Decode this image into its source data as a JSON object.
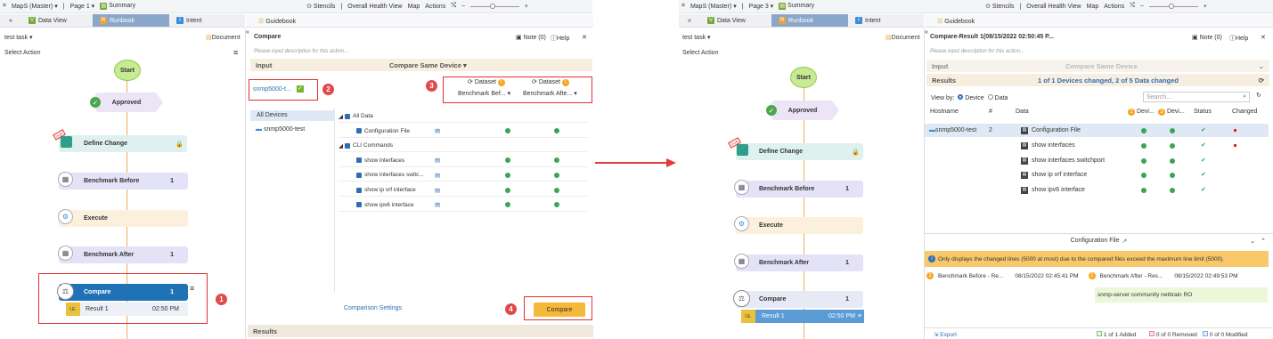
{
  "left": {
    "topbar": {
      "map": "MapS (Master)",
      "page": "Page 1",
      "summary": "Summary",
      "stencils": "Stencils",
      "overall": "Overall Health View",
      "map_menu": "Map",
      "actions": "Actions"
    },
    "tabs": [
      "Data View",
      "Runbook",
      "Intent"
    ],
    "guidebook": "Guidebook",
    "runbook": {
      "task": "test task",
      "document": "Document",
      "select_action": "Select Action",
      "nodes": {
        "start": "Start",
        "approved": "Approved",
        "define_change": "Define Change",
        "benchmark_before": "Benchmark Before",
        "benchmark_before_count": "1",
        "execute": "Execute",
        "benchmark_after": "Benchmark After",
        "benchmark_after_count": "1",
        "compare": "Compare",
        "compare_count": "1",
        "result": "Result 1",
        "result_time": "02:50 PM",
        "draft_tag": "Draft"
      }
    },
    "compare": {
      "title": "Compare",
      "note": "Note (0)",
      "help": "Help",
      "placeholder": "Please input description for this action...",
      "input": "Input",
      "mode": "Compare Same Device",
      "device_chip": "snmp5000-t...",
      "dataset1": "Dataset",
      "dataset2": "Dataset",
      "ds1_value": "Benchmark Bef...",
      "ds2_value": "Benchmark Afte...",
      "devices": [
        "All Devices",
        "snmp5000-test"
      ],
      "data_rows": [
        {
          "label": "All Data",
          "kind": "head"
        },
        {
          "label": "Configuration File",
          "kind": "item"
        },
        {
          "label": "CLI Commands",
          "kind": "head"
        },
        {
          "label": "show interfaces",
          "kind": "cmd"
        },
        {
          "label": "show interfaces switc...",
          "kind": "cmd"
        },
        {
          "label": "show ip vrf interface",
          "kind": "cmd"
        },
        {
          "label": "show ipv6 interface",
          "kind": "cmd"
        }
      ],
      "settings": "Comparison Settings",
      "compare_btn": "Compare",
      "results": "Results"
    },
    "callouts": [
      "1",
      "2",
      "3",
      "4"
    ]
  },
  "right": {
    "topbar": {
      "map": "MapS (Master)",
      "page": "Page 3",
      "summary": "Summary",
      "stencils": "Stencils",
      "overall": "Overall Health View",
      "map_menu": "Map",
      "actions": "Actions"
    },
    "tabs": [
      "Data View",
      "Runbook",
      "Intent"
    ],
    "guidebook": "Guidebook",
    "runbook": {
      "task": "test task",
      "document": "Document",
      "select_action": "Select Action",
      "nodes": {
        "start": "Start",
        "approved": "Approved",
        "define_change": "Define Change",
        "benchmark_before": "Benchmark Before",
        "benchmark_before_count": "1",
        "execute": "Execute",
        "benchmark_after": "Benchmark After",
        "benchmark_after_count": "1",
        "compare": "Compare",
        "compare_count": "1",
        "result": "Result 1",
        "result_time": "02:50 PM",
        "draft_tag": "Draft"
      }
    },
    "result": {
      "title": "Compare-Result 1(08/15/2022 02:50:45 P...",
      "note": "Note (0)",
      "help": "Help",
      "placeholder": "Please input description for this action...",
      "input": "Input",
      "mode": "Compare Same Device",
      "results": "Results",
      "summary": "1 of 1 Devices changed, 2 of 5 Data changed",
      "view_by": "View by:",
      "by_device": "Device",
      "by_data": "Data",
      "search": "Search...",
      "headers": [
        "Hostname",
        "#",
        "Data",
        "Devi...",
        "Devi...",
        "Status",
        "Changed"
      ],
      "host": "snmp5000-test",
      "count": "2",
      "rows": [
        {
          "data": "Configuration File",
          "changed": true
        },
        {
          "data": "show interfaces",
          "changed": true
        },
        {
          "data": "show interfaces switchport",
          "changed": false
        },
        {
          "data": "show ip vrf interface",
          "changed": false
        },
        {
          "data": "show ipv6 interface",
          "changed": false
        }
      ],
      "config_title": "Configuration File",
      "warning": "Only displays the changed lines (5000 at most) due to the compared files exceed the maximum line limit (5000).",
      "before": "Benchmark Before - Re...",
      "before_time": "08/15/2022 02:45:41 PM",
      "after": "Benchmark After - Res...",
      "after_time": "08/15/2022 02:49:53 PM",
      "diff_line": "snmp-server community netbrain RO",
      "export": "Export",
      "added": "1 of 1 Added",
      "removed": "0 of 0 Removed",
      "modified": "0 of 0 Modified"
    }
  },
  "colors": {
    "accent": "#2f6db5",
    "warn": "#f5b93a",
    "callout": "#e03030",
    "arrow": "#e03a3a"
  }
}
